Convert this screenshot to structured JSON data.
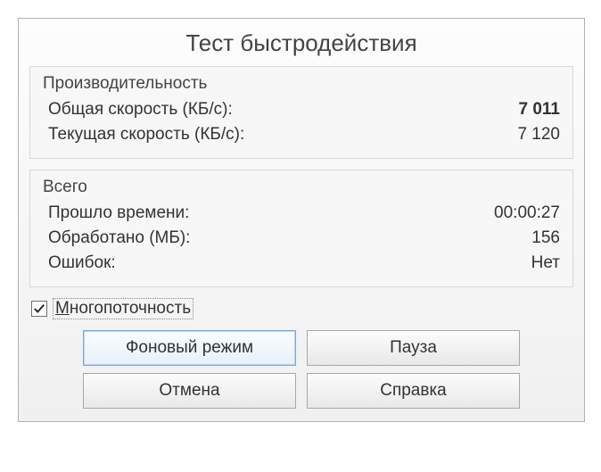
{
  "title": "Тест быстродействия",
  "perf": {
    "heading": "Производительность",
    "overall_label": "Общая скорость (КБ/с):",
    "overall_value": "7 011",
    "current_label": "Текущая скорость (КБ/с):",
    "current_value": "7 120"
  },
  "total": {
    "heading": "Всего",
    "elapsed_label": "Прошло времени:",
    "elapsed_value": "00:00:27",
    "processed_label": "Обработано (МБ):",
    "processed_value": "156",
    "errors_label": "Ошибок:",
    "errors_value": "Нет"
  },
  "checkbox": {
    "checked": true,
    "label_first": "М",
    "label_rest": "ногопоточность"
  },
  "buttons": {
    "background": "Фоновый режим",
    "pause": "Пауза",
    "cancel": "Отмена",
    "help": "Справка"
  }
}
